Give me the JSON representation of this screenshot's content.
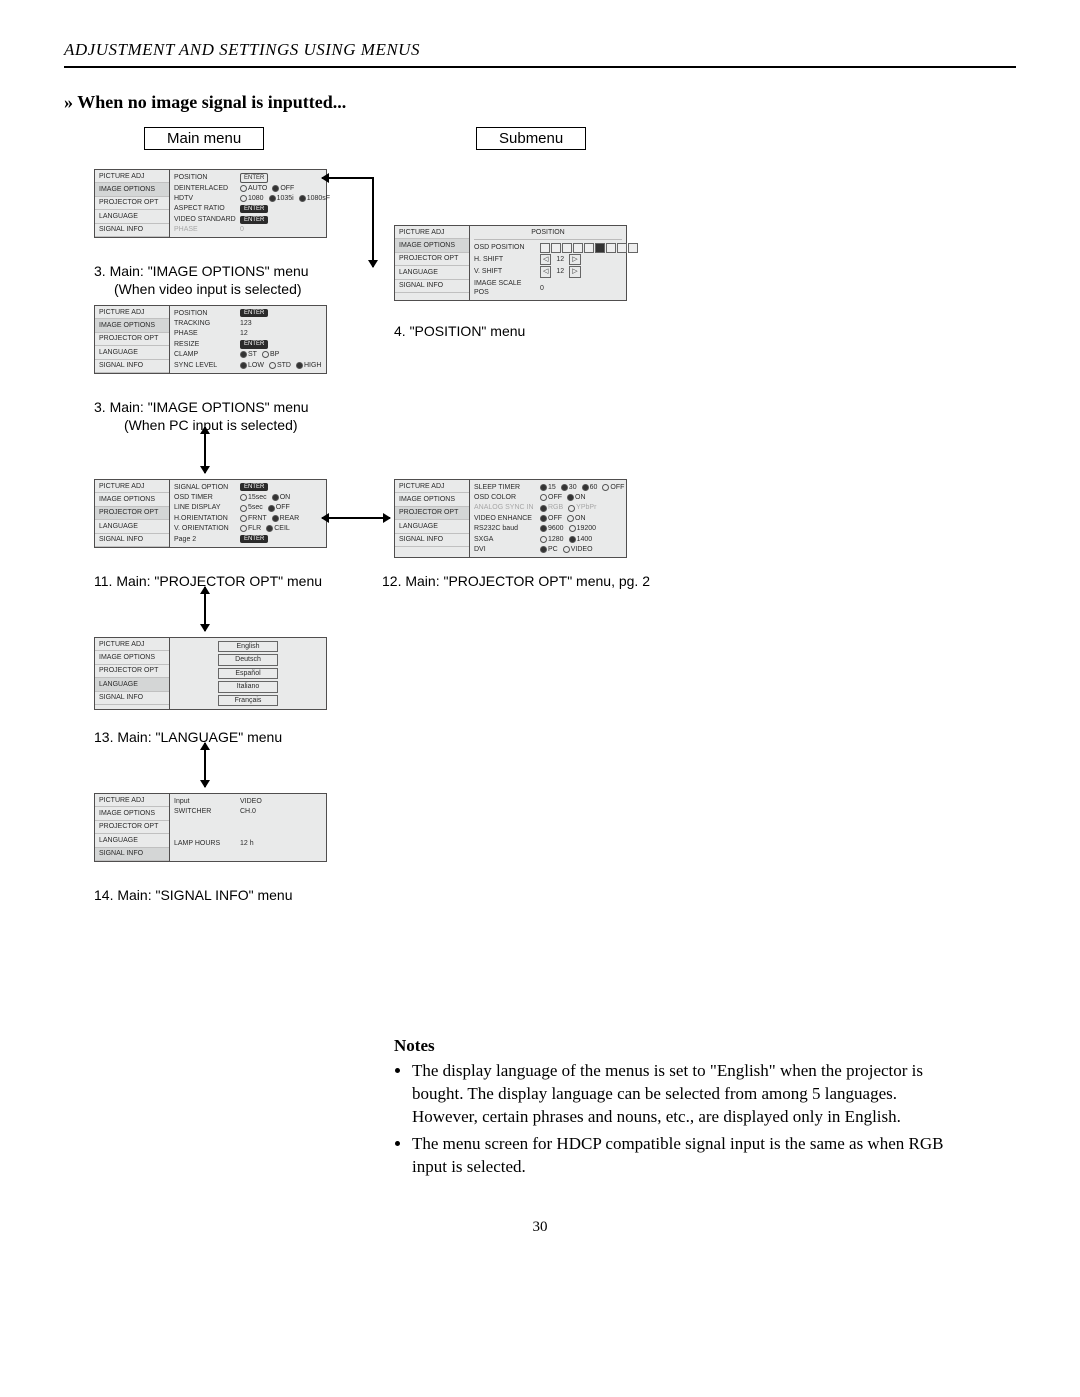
{
  "header": "ADJUSTMENT AND SETTINGS USING MENUS",
  "section_title": "When no image signal is inputted...",
  "labels": {
    "main_menu": "Main menu",
    "submenu": "Submenu"
  },
  "side_items": [
    "PICTURE ADJ",
    "IMAGE OPTIONS",
    "PROJECTOR OPT",
    "LANGUAGE",
    "SIGNAL INFO"
  ],
  "captions": {
    "m3_video": "3. Main: \"IMAGE OPTIONS\" menu",
    "m3_video_sub": "(When video input is selected)",
    "m3_pc": "3. Main: \"IMAGE OPTIONS\" menu",
    "m3_pc_sub": "(When PC input is selected)",
    "m4": "4. \"POSITION\" menu",
    "m11": "11. Main: \"PROJECTOR OPT\" menu",
    "m12": "12. Main: \"PROJECTOR OPT\" menu, pg. 2",
    "m13": "13. Main: \"LANGUAGE\" menu",
    "m14": "14. Main: \"SIGNAL INFO\" menu"
  },
  "menus": {
    "img_video": {
      "rows": [
        {
          "label": "POSITION",
          "value_type": "enter_outline",
          "text": "ENTER"
        },
        {
          "label": "DEINTERLACED",
          "value_type": "radios",
          "opts": [
            {
              "t": "AUTO",
              "on": false
            },
            {
              "t": "OFF",
              "on": true
            }
          ]
        },
        {
          "label": "HDTV",
          "value_type": "radios",
          "opts": [
            {
              "t": "1080",
              "on": false
            },
            {
              "t": "1035i",
              "on": true
            },
            {
              "t": "1080sF",
              "on": true
            }
          ]
        },
        {
          "label": "ASPECT RATIO",
          "value_type": "enter",
          "text": "ENTER"
        },
        {
          "label": "VIDEO STANDARD",
          "value_type": "enter",
          "text": "ENTER"
        },
        {
          "label": "PHASE",
          "value_type": "gray",
          "text": "0"
        }
      ]
    },
    "img_pc": {
      "rows": [
        {
          "label": "POSITION",
          "value_type": "enter",
          "text": "ENTER"
        },
        {
          "label": "TRACKING",
          "value_type": "text",
          "text": "123"
        },
        {
          "label": "PHASE",
          "value_type": "text",
          "text": "12"
        },
        {
          "label": "RESIZE",
          "value_type": "enter",
          "text": "ENTER"
        },
        {
          "label": "CLAMP",
          "value_type": "radios",
          "opts": [
            {
              "t": "ST",
              "on": true
            },
            {
              "t": "BP",
              "on": false
            }
          ]
        },
        {
          "label": "SYNC LEVEL",
          "value_type": "radios",
          "opts": [
            {
              "t": "LOW",
              "on": true
            },
            {
              "t": "STD",
              "on": false
            },
            {
              "t": "HIGH",
              "on": true
            }
          ]
        }
      ]
    },
    "position": {
      "title": "POSITION",
      "rows": [
        {
          "label": "OSD POSITION",
          "value_type": "posicons"
        },
        {
          "label": "H. SHIFT",
          "value_type": "shift",
          "text": "12"
        },
        {
          "label": "V. SHIFT",
          "value_type": "shift",
          "text": "12"
        },
        {
          "label": "IMAGE SCALE POS",
          "value_type": "text",
          "text": "0"
        }
      ]
    },
    "proj1": {
      "rows": [
        {
          "label": "SIGNAL OPTION",
          "value_type": "enter",
          "text": "ENTER"
        },
        {
          "label": "OSD TIMER",
          "value_type": "radios",
          "opts": [
            {
              "t": "15sec",
              "on": false
            },
            {
              "t": "ON",
              "on": true
            }
          ]
        },
        {
          "label": "LINE DISPLAY",
          "value_type": "radios",
          "opts": [
            {
              "t": "5sec",
              "on": false
            },
            {
              "t": "OFF",
              "on": true
            }
          ]
        },
        {
          "label": "H.ORIENTATION",
          "value_type": "radios",
          "opts": [
            {
              "t": "FRNT",
              "on": false
            },
            {
              "t": "REAR",
              "on": true
            }
          ]
        },
        {
          "label": "V. ORIENTATION",
          "value_type": "radios",
          "opts": [
            {
              "t": "FLR",
              "on": false
            },
            {
              "t": "CEIL",
              "on": true
            }
          ]
        },
        {
          "label": "Page   2",
          "value_type": "enter",
          "text": "ENTER"
        }
      ]
    },
    "proj2": {
      "rows": [
        {
          "label": "SLEEP TIMER",
          "value_type": "radios",
          "opts": [
            {
              "t": "15",
              "on": true
            },
            {
              "t": "30",
              "on": true
            },
            {
              "t": "60",
              "on": true
            },
            {
              "t": "OFF",
              "on": false
            }
          ]
        },
        {
          "label": "OSD COLOR",
          "value_type": "radios",
          "opts": [
            {
              "t": "OFF",
              "on": false
            },
            {
              "t": "ON",
              "on": true
            }
          ]
        },
        {
          "label": "ANALOG SYNC IN",
          "value_type": "radios",
          "gray": true,
          "opts": [
            {
              "t": "RGB",
              "on": true
            },
            {
              "t": "YPbPr",
              "on": false
            }
          ]
        },
        {
          "label": "VIDEO ENHANCE",
          "value_type": "radios",
          "opts": [
            {
              "t": "OFF",
              "on": true
            },
            {
              "t": "ON",
              "on": false
            }
          ]
        },
        {
          "label": "RS232C baud",
          "value_type": "radios",
          "opts": [
            {
              "t": "9600",
              "on": true
            },
            {
              "t": "19200",
              "on": false
            }
          ]
        },
        {
          "label": "SXGA",
          "value_type": "radios",
          "opts": [
            {
              "t": "1280",
              "on": false
            },
            {
              "t": "1400",
              "on": true
            }
          ]
        },
        {
          "label": "DVI",
          "value_type": "radios",
          "opts": [
            {
              "t": "PC",
              "on": true
            },
            {
              "t": "VIDEO",
              "on": false
            }
          ]
        }
      ]
    },
    "language": {
      "items": [
        "English",
        "Deutsch",
        "Español",
        "Italiano",
        "Français"
      ]
    },
    "signal_info": {
      "rows": [
        {
          "label": "Input",
          "value_type": "text",
          "text": "VIDEO"
        },
        {
          "label": "SWITCHER",
          "value_type": "text",
          "text": "CH.0"
        },
        {
          "label": "",
          "value_type": "spacer"
        },
        {
          "label": "",
          "value_type": "spacer"
        },
        {
          "label": "LAMP HOURS",
          "value_type": "text",
          "text": "12 h"
        }
      ]
    }
  },
  "notes": {
    "title": "Notes",
    "items": [
      "The display language of the menus is set to \"English\" when the projector is bought. The display language can be selected from among 5 languages. However, certain phrases and nouns, etc., are displayed only in English.",
      "The menu screen for HDCP compatible signal input is the same as when RGB input is selected."
    ]
  },
  "page_number": "30"
}
